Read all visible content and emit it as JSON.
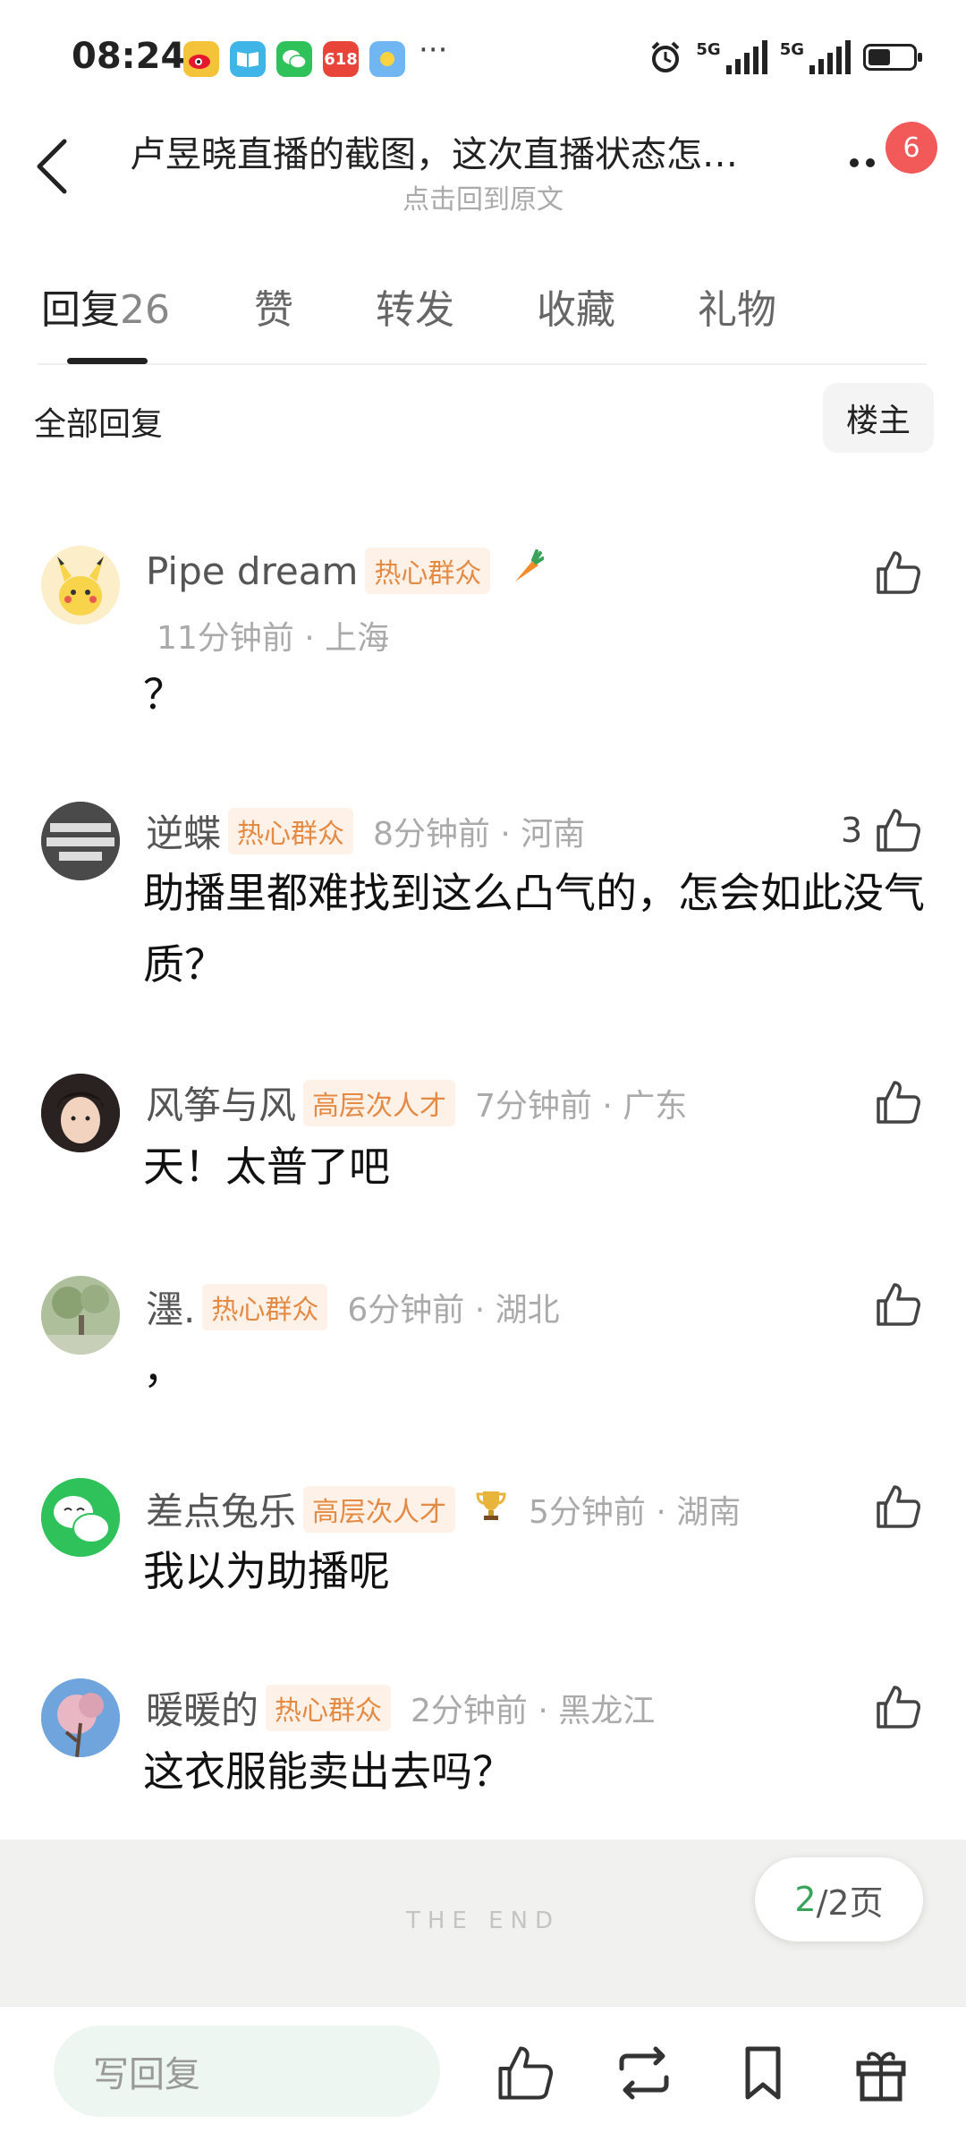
{
  "status_bar": {
    "time": "08:24",
    "network_left": "5G",
    "network_right": "5G",
    "app_icons": [
      "weibo-icon",
      "book-icon",
      "wechat-icon",
      "shopping-618-icon",
      "weather-icon"
    ],
    "more": "···"
  },
  "header": {
    "title": "卢昱晓直播的截图，这次直播状态怎…",
    "subtitle": "点击回到原文",
    "notification_count": "6"
  },
  "tabs": [
    {
      "label": "回复",
      "count": "26",
      "active": true
    },
    {
      "label": "赞"
    },
    {
      "label": "转发"
    },
    {
      "label": "收藏"
    },
    {
      "label": "礼物"
    }
  ],
  "filter": {
    "label": "全部回复",
    "op_button": "楼主"
  },
  "comments": [
    {
      "name": "Pipe dream",
      "badge": "热心群众",
      "time": "11分钟前",
      "location": "上海",
      "text": "？",
      "likes": "",
      "emoji": "carrot-icon"
    },
    {
      "name": "逆蝶",
      "badge": "热心群众",
      "time": "8分钟前",
      "location": "河南",
      "text": "助播里都难找到这么凸气的，怎会如此没气质？",
      "likes": "3"
    },
    {
      "name": "风筝与风",
      "badge": "高层次人才",
      "time": "7分钟前",
      "location": "广东",
      "text": "天！太普了吧",
      "likes": ""
    },
    {
      "name": "濹.",
      "badge": "热心群众",
      "time": "6分钟前",
      "location": "湖北",
      "text": "，",
      "likes": ""
    },
    {
      "name": "差点兔乐",
      "badge": "高层次人才",
      "time": "5分钟前",
      "location": "湖南",
      "text": "我以为助播呢",
      "likes": "",
      "emoji": "trophy-icon"
    },
    {
      "name": "暖暖的",
      "badge": "热心群众",
      "time": "2分钟前",
      "location": "黑龙江",
      "text": "这衣服能卖出去吗？",
      "likes": ""
    }
  ],
  "end_text": "THE END",
  "pager": {
    "current": "2",
    "total": "/2页"
  },
  "bottom_bar": {
    "reply_placeholder": "写回复"
  },
  "colors": {
    "accent_green": "#3aa35a",
    "badge_bg": "#fdf1e8",
    "badge_text": "#e58a43",
    "notif_red": "#f25a5a"
  }
}
